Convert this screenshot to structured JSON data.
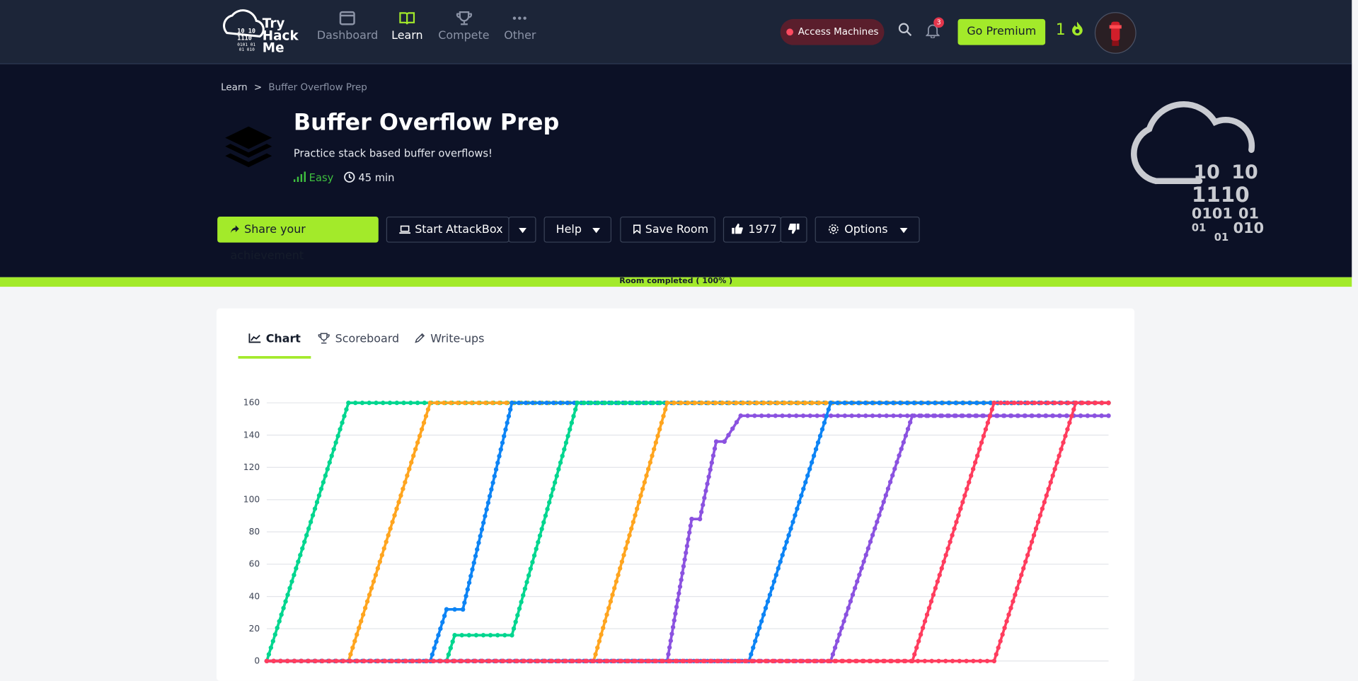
{
  "nav": {
    "logo_text": [
      "Try",
      "Hack",
      "Me"
    ],
    "items": [
      {
        "label": "Dashboard",
        "icon": "dashboard-icon"
      },
      {
        "label": "Learn",
        "icon": "book-icon"
      },
      {
        "label": "Compete",
        "icon": "trophy-icon"
      },
      {
        "label": "Other",
        "icon": "dots-icon"
      }
    ],
    "active": "Learn",
    "access_machines": "Access Machines",
    "notifications_count": "3",
    "go_premium": "Go Premium",
    "streak_count": "1",
    "colors": {
      "accent": "#a3ea2a",
      "nav_bg": "#1c2538",
      "hero_bg": "#0c1126",
      "alert": "#ff4b61"
    }
  },
  "breadcrumb": {
    "parent": "Learn",
    "separator": ">",
    "current": "Buffer Overflow Prep"
  },
  "room": {
    "title": "Buffer Overflow Prep",
    "description": "Practice stack based buffer overflows!",
    "difficulty": "Easy",
    "duration": "45 min"
  },
  "actions": {
    "share": "Share your achievement",
    "attackbox": "Start AttackBox",
    "help": "Help",
    "save": "Save Room",
    "likes": "1977",
    "options": "Options"
  },
  "art_digits": [
    "10",
    "10",
    "1110",
    "0101",
    "01",
    "01",
    "01",
    "010"
  ],
  "progress": {
    "label": "Room completed ( 100% )",
    "value": 100
  },
  "tabs": [
    {
      "label": "Chart",
      "icon": "line-chart-icon"
    },
    {
      "label": "Scoreboard",
      "icon": "trophy-icon"
    },
    {
      "label": "Write-ups",
      "icon": "pencil-icon"
    }
  ],
  "active_tab": "Chart",
  "chart_data": {
    "type": "line",
    "title": "",
    "xlabel": "",
    "ylabel": "",
    "ylim": [
      0,
      160
    ],
    "y_ticks": [
      "0",
      "20",
      "40",
      "60",
      "80",
      "100",
      "120",
      "140",
      "160"
    ],
    "grid": true,
    "series": [
      {
        "color": "#00d68f",
        "points": [
          [
            0,
            0
          ],
          [
            1,
            160
          ],
          [
            14,
            160
          ]
        ]
      },
      {
        "color": "#ffa51f",
        "points": [
          [
            0,
            0
          ],
          [
            1,
            0
          ],
          [
            2,
            160
          ],
          [
            14,
            160
          ]
        ]
      },
      {
        "color": "#0d84f5",
        "points": [
          [
            0,
            0
          ],
          [
            2,
            0
          ],
          [
            2.2,
            32
          ],
          [
            2.4,
            32
          ],
          [
            3,
            160
          ],
          [
            14,
            160
          ]
        ]
      },
      {
        "color": "#00d68f",
        "points": [
          [
            0,
            0
          ],
          [
            2.2,
            0
          ],
          [
            2.3,
            16
          ],
          [
            3,
            16
          ],
          [
            3.8,
            160
          ],
          [
            14,
            160
          ]
        ]
      },
      {
        "color": "#ffa51f",
        "points": [
          [
            0,
            0
          ],
          [
            4,
            0
          ],
          [
            4.9,
            160
          ],
          [
            14,
            160
          ]
        ]
      },
      {
        "color": "#8b52e0",
        "points": [
          [
            0,
            0
          ],
          [
            4.9,
            0
          ],
          [
            5.2,
            88
          ],
          [
            5.3,
            88
          ],
          [
            5.5,
            136
          ],
          [
            5.6,
            136
          ],
          [
            5.8,
            152
          ],
          [
            14,
            152
          ]
        ]
      },
      {
        "color": "#0d84f5",
        "points": [
          [
            0,
            0
          ],
          [
            5.9,
            0
          ],
          [
            6.9,
            160
          ],
          [
            14,
            160
          ]
        ]
      },
      {
        "color": "#8b52e0",
        "points": [
          [
            0,
            0
          ],
          [
            6.9,
            0
          ],
          [
            7.9,
            152
          ],
          [
            14,
            152
          ]
        ]
      },
      {
        "color": "#ff3d5e",
        "points": [
          [
            0,
            0
          ],
          [
            7.9,
            0
          ],
          [
            8.9,
            160
          ],
          [
            14,
            160
          ]
        ]
      },
      {
        "color": "#ff3d5e",
        "points": [
          [
            0,
            0
          ],
          [
            8.9,
            0
          ],
          [
            9.9,
            160
          ],
          [
            14,
            160
          ]
        ]
      }
    ]
  }
}
